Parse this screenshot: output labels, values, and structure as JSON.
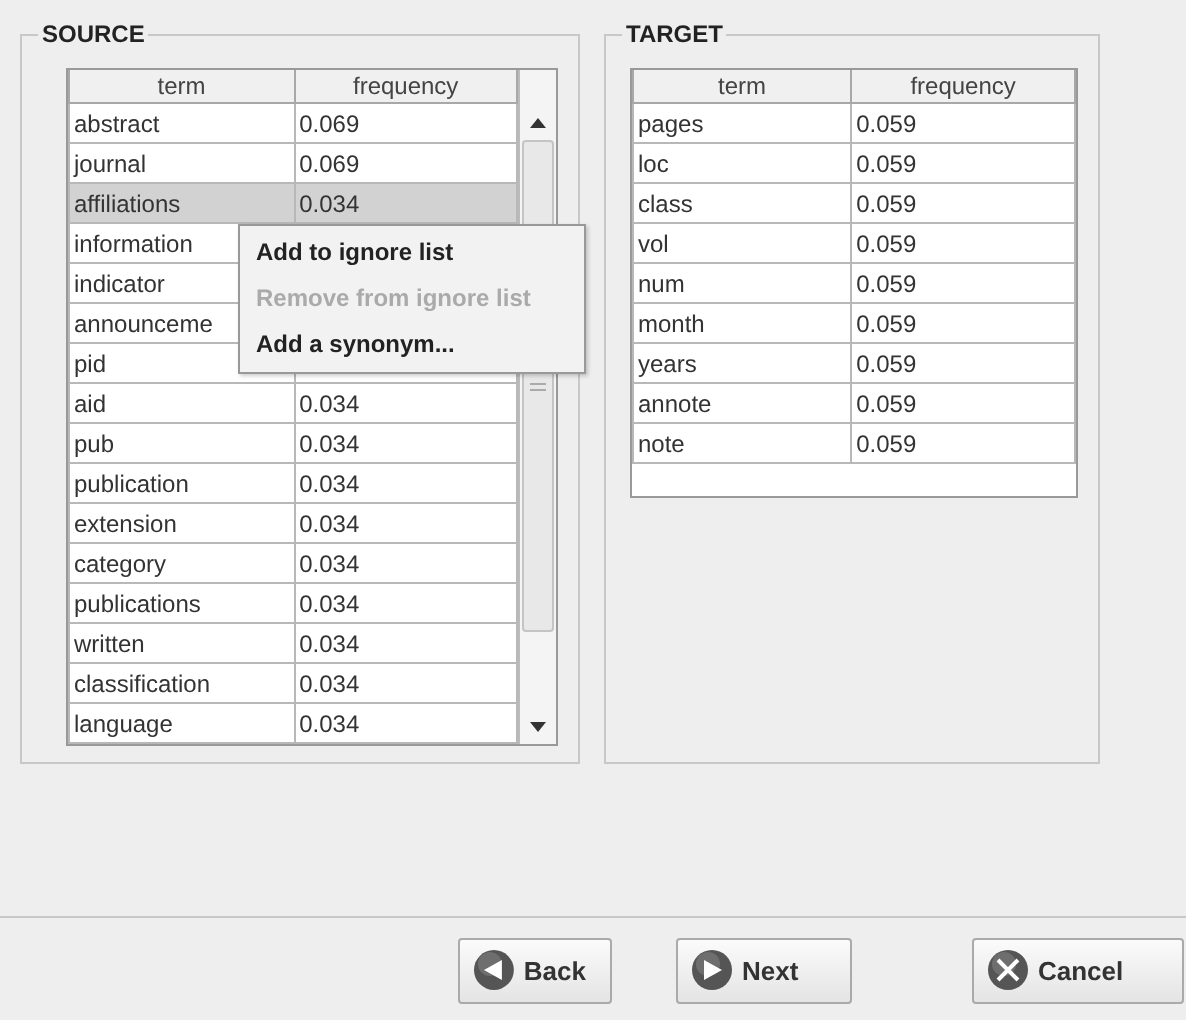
{
  "source": {
    "title": "SOURCE",
    "columns": [
      "term",
      "frequency"
    ],
    "rows": [
      {
        "term": "abstract",
        "frequency": "0.069",
        "selected": false
      },
      {
        "term": "journal",
        "frequency": "0.069",
        "selected": false
      },
      {
        "term": "affiliations",
        "frequency": "0.034",
        "selected": true
      },
      {
        "term": "information",
        "selected": false
      },
      {
        "term": "indicator",
        "selected": false
      },
      {
        "term": "announceme",
        "selected": false
      },
      {
        "term": "pid",
        "selected": false
      },
      {
        "term": "aid",
        "frequency": "0.034",
        "selected": false
      },
      {
        "term": "pub",
        "frequency": "0.034",
        "selected": false
      },
      {
        "term": "publication",
        "frequency": "0.034",
        "selected": false
      },
      {
        "term": "extension",
        "frequency": "0.034",
        "selected": false
      },
      {
        "term": "category",
        "frequency": "0.034",
        "selected": false
      },
      {
        "term": "publications",
        "frequency": "0.034",
        "selected": false
      },
      {
        "term": "written",
        "frequency": "0.034",
        "selected": false
      },
      {
        "term": "classification",
        "frequency": "0.034",
        "selected": false
      },
      {
        "term": "language",
        "frequency": "0.034",
        "selected": false
      }
    ]
  },
  "target": {
    "title": "TARGET",
    "columns": [
      "term",
      "frequency"
    ],
    "rows": [
      {
        "term": "pages",
        "frequency": "0.059"
      },
      {
        "term": "loc",
        "frequency": "0.059"
      },
      {
        "term": "class",
        "frequency": "0.059"
      },
      {
        "term": "vol",
        "frequency": "0.059"
      },
      {
        "term": "num",
        "frequency": "0.059"
      },
      {
        "term": "month",
        "frequency": "0.059"
      },
      {
        "term": "years",
        "frequency": "0.059"
      },
      {
        "term": "annote",
        "frequency": "0.059"
      },
      {
        "term": "note",
        "frequency": "0.059"
      }
    ]
  },
  "context_menu": [
    {
      "label": "Add to ignore list",
      "disabled": false
    },
    {
      "label": "Remove from ignore list",
      "disabled": true
    },
    {
      "label": "Add a synonym...",
      "disabled": false
    }
  ],
  "buttons": [
    {
      "label": "Back",
      "kind": "back"
    },
    {
      "label": "Next",
      "kind": "next"
    },
    {
      "label": "Cancel",
      "kind": "cancel"
    }
  ]
}
